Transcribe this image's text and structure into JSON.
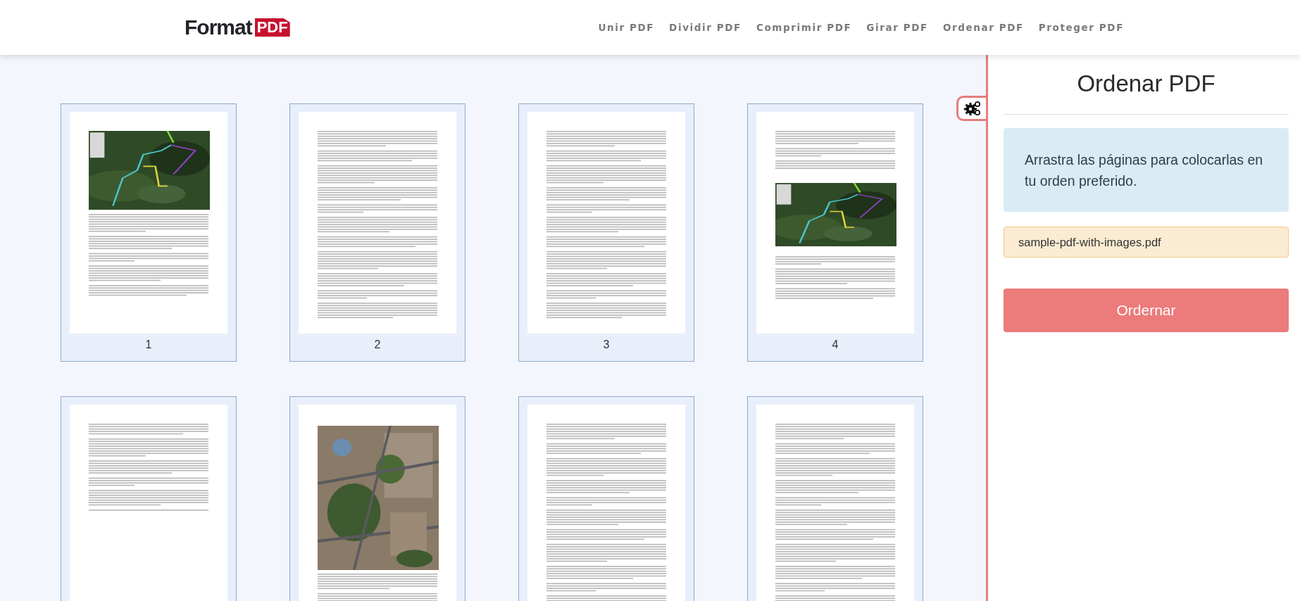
{
  "header": {
    "logo": {
      "word": "Format",
      "badge": "PDF"
    },
    "nav": [
      "Unir PDF",
      "Dividir PDF",
      "Comprimir PDF",
      "Girar PDF",
      "Ordenar PDF",
      "Proteger PDF"
    ]
  },
  "pages": [
    {
      "kind": "image-top",
      "number": "1"
    },
    {
      "kind": "text",
      "number": "2"
    },
    {
      "kind": "text",
      "number": "3"
    },
    {
      "kind": "image-middle",
      "number": "4"
    },
    {
      "kind": "text-short"
    },
    {
      "kind": "image-large"
    },
    {
      "kind": "text"
    },
    {
      "kind": "text"
    }
  ],
  "sidebar": {
    "title": "Ordenar PDF",
    "instructions": "Arrastra las páginas para colocarlas en tu orden preferido.",
    "file_name": "sample-pdf-with-images.pdf",
    "button": "Ordernar"
  }
}
